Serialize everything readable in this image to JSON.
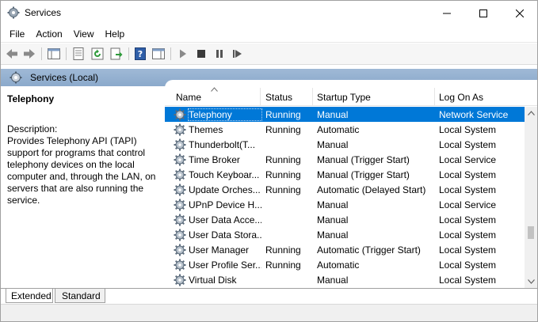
{
  "window": {
    "title": "Services"
  },
  "menu": {
    "items": [
      "File",
      "Action",
      "View",
      "Help"
    ]
  },
  "toolbar": {
    "buttons": [
      "back-icon",
      "forward-icon",
      "show-hide-console-tree-icon",
      "properties-icon",
      "refresh-icon",
      "export-list-icon",
      "help-icon",
      "show-hide-action-pane-icon",
      "start-service-icon",
      "stop-service-icon",
      "pause-service-icon",
      "restart-service-icon"
    ]
  },
  "scope": {
    "title": "Services (Local)"
  },
  "details": {
    "service_name": "Telephony",
    "description_label": "Description:",
    "description_text": "Provides Telephony API (TAPI) support for programs that control telephony devices on the local computer and, through the LAN, on servers that are also running the service."
  },
  "table": {
    "columns": {
      "name": "Name",
      "status": "Status",
      "startup": "Startup Type",
      "logon": "Log On As"
    },
    "sorted_column": "name",
    "rows": [
      {
        "name": "Telephony",
        "status": "Running",
        "startup": "Manual",
        "logon": "Network Service",
        "selected": true
      },
      {
        "name": "Themes",
        "status": "Running",
        "startup": "Automatic",
        "logon": "Local System"
      },
      {
        "name": "Thunderbolt(T...",
        "status": "",
        "startup": "Manual",
        "logon": "Local System"
      },
      {
        "name": "Time Broker",
        "status": "Running",
        "startup": "Manual (Trigger Start)",
        "logon": "Local Service"
      },
      {
        "name": "Touch Keyboar...",
        "status": "Running",
        "startup": "Manual (Trigger Start)",
        "logon": "Local System"
      },
      {
        "name": "Update Orches...",
        "status": "Running",
        "startup": "Automatic (Delayed Start)",
        "logon": "Local System"
      },
      {
        "name": "UPnP Device H...",
        "status": "",
        "startup": "Manual",
        "logon": "Local Service"
      },
      {
        "name": "User Data Acce...",
        "status": "",
        "startup": "Manual",
        "logon": "Local System"
      },
      {
        "name": "User Data Stora...",
        "status": "",
        "startup": "Manual",
        "logon": "Local System"
      },
      {
        "name": "User Manager",
        "status": "Running",
        "startup": "Automatic (Trigger Start)",
        "logon": "Local System"
      },
      {
        "name": "User Profile Ser...",
        "status": "Running",
        "startup": "Automatic",
        "logon": "Local System"
      },
      {
        "name": "Virtual Disk",
        "status": "",
        "startup": "Manual",
        "logon": "Local System"
      }
    ]
  },
  "tabs": {
    "extended": "Extended",
    "standard": "Standard",
    "active": "extended"
  },
  "colors": {
    "selection": "#0078d7",
    "scope_header": "#9fb9d6"
  }
}
